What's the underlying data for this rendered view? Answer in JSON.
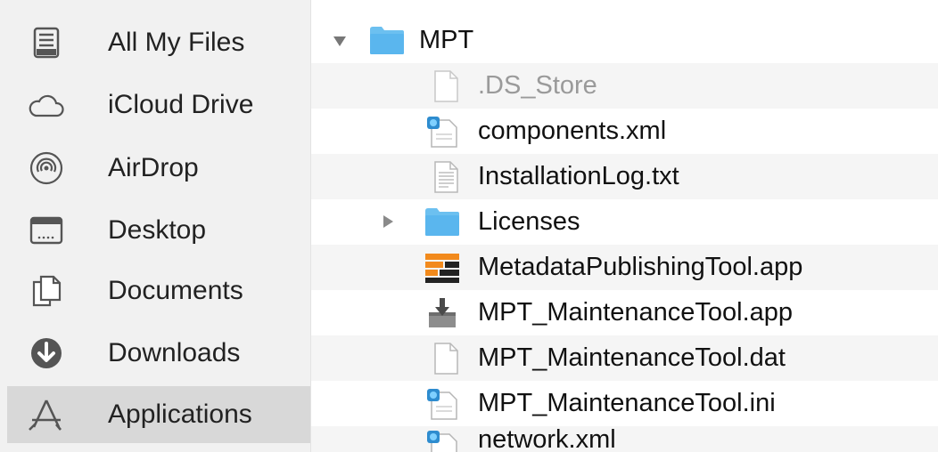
{
  "sidebar": {
    "items": [
      {
        "label": "All My Files",
        "icon": "all-my-files-icon"
      },
      {
        "label": "iCloud Drive",
        "icon": "cloud-icon"
      },
      {
        "label": "AirDrop",
        "icon": "airdrop-icon"
      },
      {
        "label": "Desktop",
        "icon": "desktop-icon"
      },
      {
        "label": "Documents",
        "icon": "documents-icon"
      },
      {
        "label": "Downloads",
        "icon": "downloads-icon"
      },
      {
        "label": "Applications",
        "icon": "applications-icon",
        "selected": true
      }
    ]
  },
  "files": [
    {
      "name": "MPT",
      "icon": "folder-icon",
      "disclosure": "expanded"
    },
    {
      "name": ".DS_Store",
      "icon": "blank-document-icon",
      "dimmed": true
    },
    {
      "name": "components.xml",
      "icon": "xml-document-icon"
    },
    {
      "name": "InstallationLog.txt",
      "icon": "text-document-icon"
    },
    {
      "name": "Licenses",
      "icon": "folder-icon",
      "disclosure": "collapsed"
    },
    {
      "name": "MetadataPublishingTool.app",
      "icon": "app-icon"
    },
    {
      "name": "MPT_MaintenanceTool.app",
      "icon": "installer-app-icon"
    },
    {
      "name": "MPT_MaintenanceTool.dat",
      "icon": "blank-document-icon"
    },
    {
      "name": "MPT_MaintenanceTool.ini",
      "icon": "xml-document-icon"
    },
    {
      "name": "network.xml",
      "icon": "xml-document-icon"
    }
  ],
  "colors": {
    "folder": "#5ab6ee",
    "sidebar_bg": "#f1f1f1",
    "selected_bg": "#d8d8d8",
    "alt_row": "#f5f5f5",
    "app_orange": "#f28a1c"
  }
}
